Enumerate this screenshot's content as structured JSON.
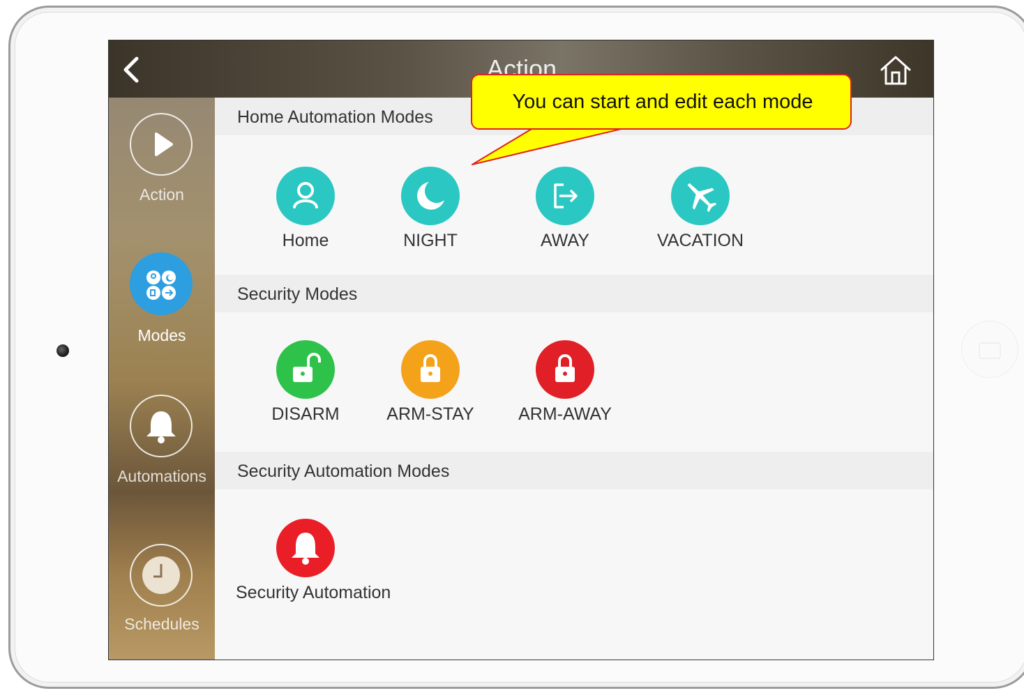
{
  "app": {
    "title": "Action"
  },
  "sidebar": {
    "items": [
      {
        "label": "Action",
        "icon": "play-icon",
        "active": false
      },
      {
        "label": "Modes",
        "icon": "modes-grid-icon",
        "active": true
      },
      {
        "label": "Automations",
        "icon": "bell-icon",
        "active": false
      },
      {
        "label": "Schedules",
        "icon": "clock-icon",
        "active": false
      }
    ]
  },
  "sections": [
    {
      "title": "Home Automation Modes",
      "modes": [
        {
          "label": "Home",
          "icon": "person-icon",
          "color": "#2bc7c2"
        },
        {
          "label": "NIGHT",
          "icon": "moon-icon",
          "color": "#2bc7c2"
        },
        {
          "label": "AWAY",
          "icon": "exit-icon",
          "color": "#2bc7c2"
        },
        {
          "label": "VACATION",
          "icon": "airplane-icon",
          "color": "#2bc7c2"
        }
      ]
    },
    {
      "title": "Security Modes",
      "modes": [
        {
          "label": "DISARM",
          "icon": "unlock-icon",
          "color": "#2ec24a"
        },
        {
          "label": "ARM-STAY",
          "icon": "lock-icon",
          "color": "#f5a21b"
        },
        {
          "label": "ARM-AWAY",
          "icon": "lock-icon",
          "color": "#e01f26"
        }
      ]
    },
    {
      "title": "Security Automation Modes",
      "modes": [
        {
          "label": "Security Automation",
          "icon": "bell-icon",
          "color": "#ea1e27"
        }
      ]
    }
  ],
  "callout": {
    "text": "You can start and edit each mode"
  },
  "colors": {
    "accent_teal": "#2bc7c2",
    "active_nav_blue": "#2d9ee0",
    "callout_fill": "#ffff00",
    "callout_border": "#e02020"
  }
}
